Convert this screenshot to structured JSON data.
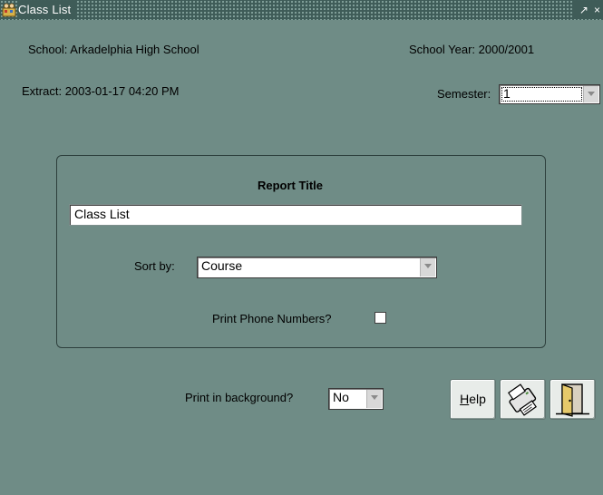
{
  "window": {
    "title": "Class List",
    "controls": {
      "restore": "↗",
      "close": "×"
    }
  },
  "header": {
    "school_label": "School:",
    "school_value": "Arkadelphia High School",
    "year_label": "School Year:",
    "year_value": "2000/2001",
    "extract_label": "Extract:",
    "extract_value": "2003-01-17 04:20 PM",
    "semester_label": "Semester:",
    "semester_value": "1"
  },
  "report": {
    "section_title": "Report Title",
    "title_value": "Class List",
    "sort_label": "Sort by:",
    "sort_value": "Course",
    "phone_label": "Print Phone Numbers?",
    "phone_checked": false
  },
  "footer": {
    "background_label": "Print in background?",
    "background_value": "No",
    "help_first": "H",
    "help_rest": "elp",
    "print_icon": "printer-icon",
    "exit_icon": "exit-door-icon"
  },
  "colors": {
    "form_background": "#6f8c86",
    "titlebar": "#3f5c58"
  }
}
